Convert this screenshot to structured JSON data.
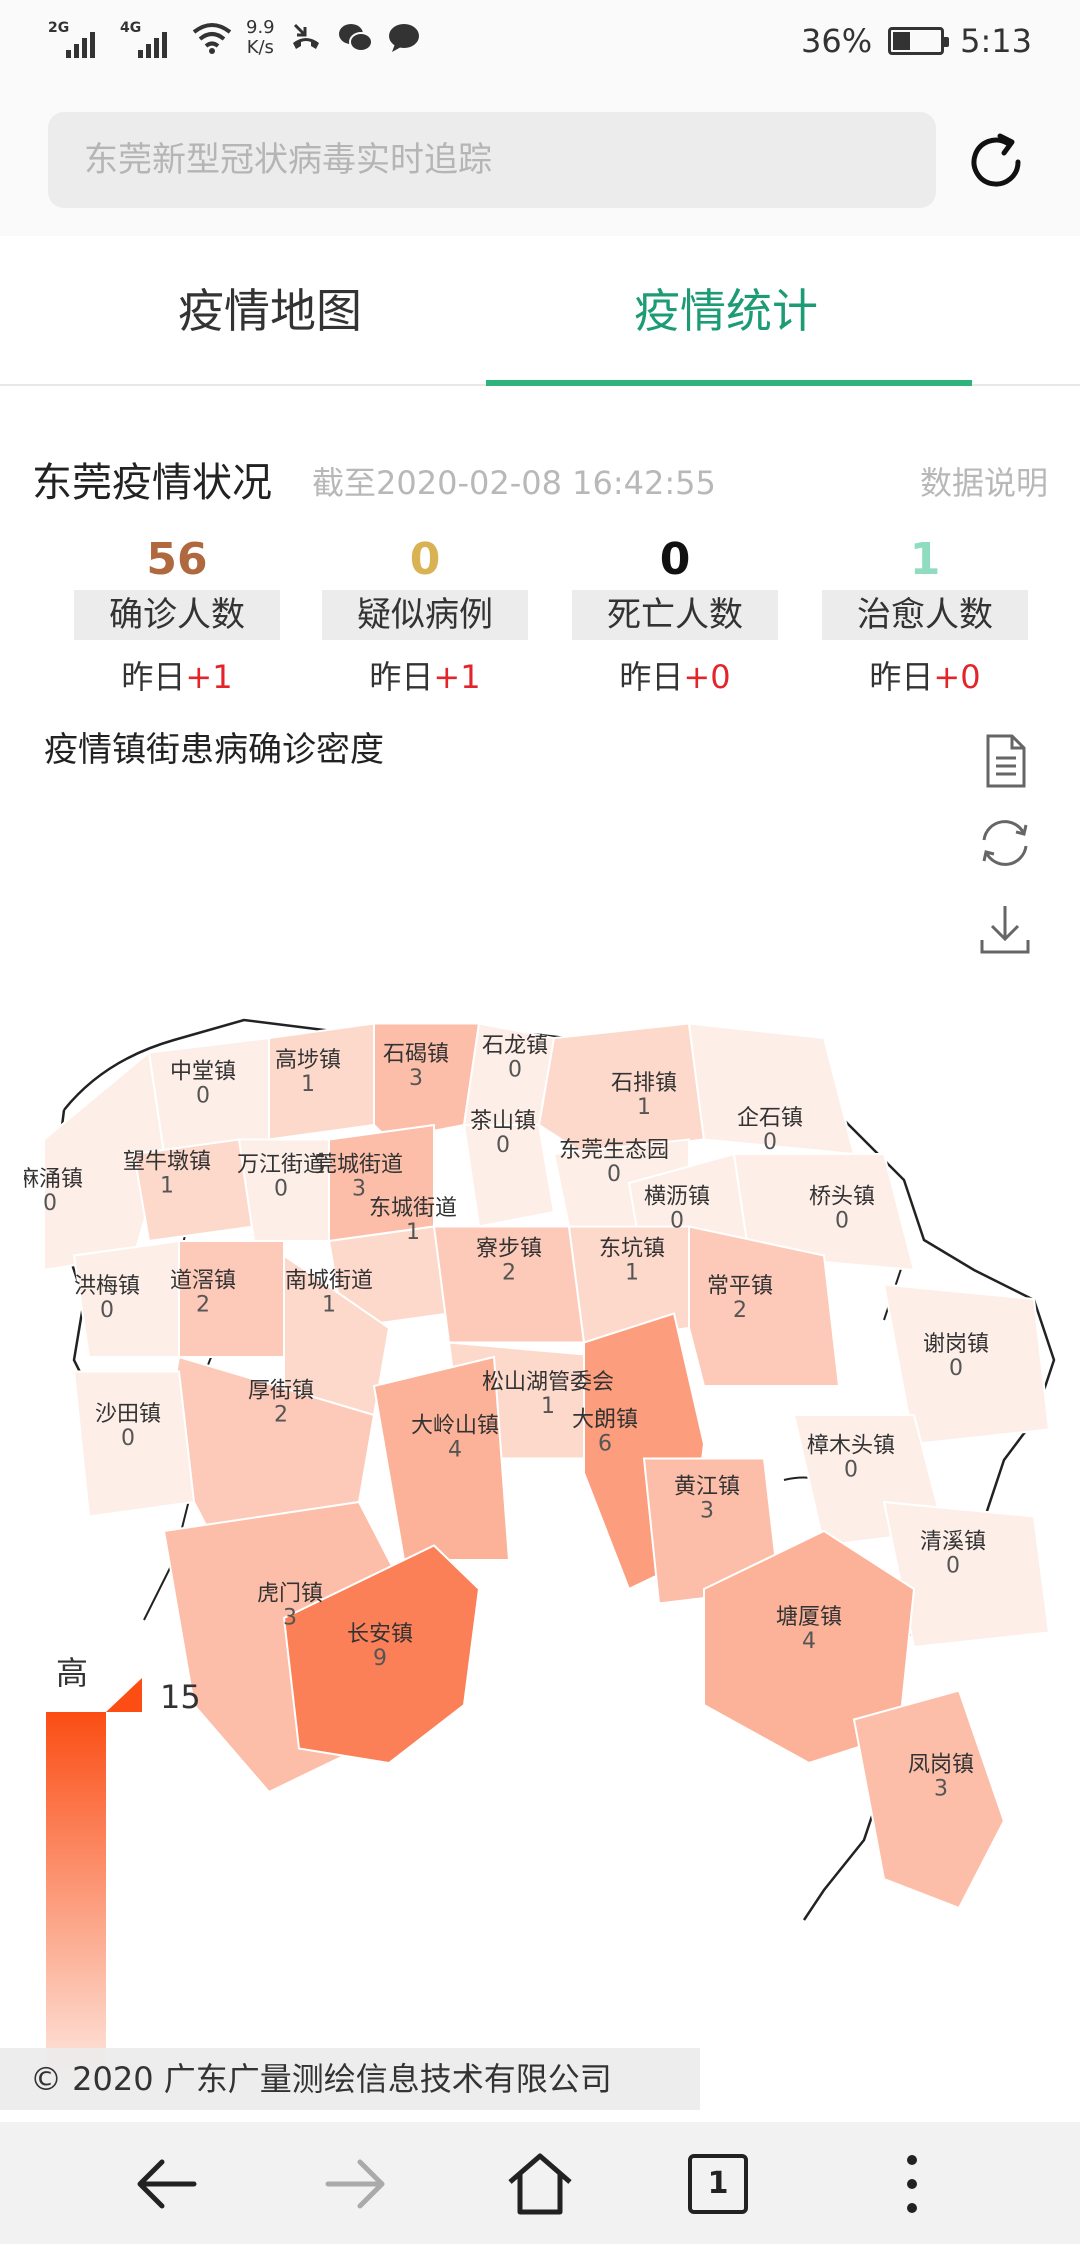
{
  "status_bar": {
    "sim1": "2G",
    "sim2": "4G",
    "speed_value": "9.9",
    "speed_unit": "K/s",
    "battery": "36%",
    "battery_level": 0.36,
    "time": "5:13"
  },
  "search": {
    "placeholder": "东莞新型冠状病毒实时追踪"
  },
  "tabs": [
    {
      "label": "疫情地图",
      "active": false
    },
    {
      "label": "疫情统计",
      "active": true
    }
  ],
  "summary": {
    "title": "东莞疫情状况",
    "as_of": "截至2020-02-08 16:42:55",
    "data_note": "数据说明"
  },
  "stats": [
    {
      "value": "56",
      "label": "确诊人数",
      "delta_prefix": "昨日",
      "delta": "+1",
      "color": "#b0683e"
    },
    {
      "value": "0",
      "label": "疑似病例",
      "delta_prefix": "昨日",
      "delta": "+1",
      "color": "#d9b253"
    },
    {
      "value": "0",
      "label": "死亡人数",
      "delta_prefix": "昨日",
      "delta": "+0",
      "color": "#111111"
    },
    {
      "value": "1",
      "label": "治愈人数",
      "delta_prefix": "昨日",
      "delta": "+0",
      "color": "#8fdcc0"
    }
  ],
  "map": {
    "title": "疫情镇街患病确诊密度",
    "legend_high": "高",
    "legend_max": "15",
    "max_value": 15,
    "towns": [
      {
        "name": "中堂镇",
        "count": "0"
      },
      {
        "name": "高埗镇",
        "count": "1"
      },
      {
        "name": "石碣镇",
        "count": "3"
      },
      {
        "name": "石龙镇",
        "count": "0"
      },
      {
        "name": "石排镇",
        "count": "1"
      },
      {
        "name": "茶山镇",
        "count": "0"
      },
      {
        "name": "企石镇",
        "count": "0"
      },
      {
        "name": "麻涌镇",
        "count": "0"
      },
      {
        "name": "望牛墩镇",
        "count": "1"
      },
      {
        "name": "万江街道",
        "count": "0"
      },
      {
        "name": "莞城街道",
        "count": "3"
      },
      {
        "name": "东莞生态园",
        "count": "0"
      },
      {
        "name": "东城街道",
        "count": "1"
      },
      {
        "name": "横沥镇",
        "count": "0"
      },
      {
        "name": "桥头镇",
        "count": "0"
      },
      {
        "name": "寮步镇",
        "count": "2"
      },
      {
        "name": "东坑镇",
        "count": "1"
      },
      {
        "name": "洪梅镇",
        "count": "0"
      },
      {
        "name": "道滘镇",
        "count": "2"
      },
      {
        "name": "南城街道",
        "count": "1"
      },
      {
        "name": "常平镇",
        "count": "2"
      },
      {
        "name": "谢岗镇",
        "count": "0"
      },
      {
        "name": "厚街镇",
        "count": "2"
      },
      {
        "name": "松山湖管委会",
        "count": "1"
      },
      {
        "name": "沙田镇",
        "count": "0"
      },
      {
        "name": "大岭山镇",
        "count": "4"
      },
      {
        "name": "大朗镇",
        "count": "6"
      },
      {
        "name": "樟木头镇",
        "count": "0"
      },
      {
        "name": "黄江镇",
        "count": "3"
      },
      {
        "name": "清溪镇",
        "count": "0"
      },
      {
        "name": "虎门镇",
        "count": "3"
      },
      {
        "name": "塘厦镇",
        "count": "4"
      },
      {
        "name": "长安镇",
        "count": "9"
      },
      {
        "name": "凤岗镇",
        "count": "3"
      }
    ]
  },
  "copyright": "© 2020 广东广量测绘信息技术有限公司",
  "bottom_nav": {
    "tab_count": "1"
  }
}
